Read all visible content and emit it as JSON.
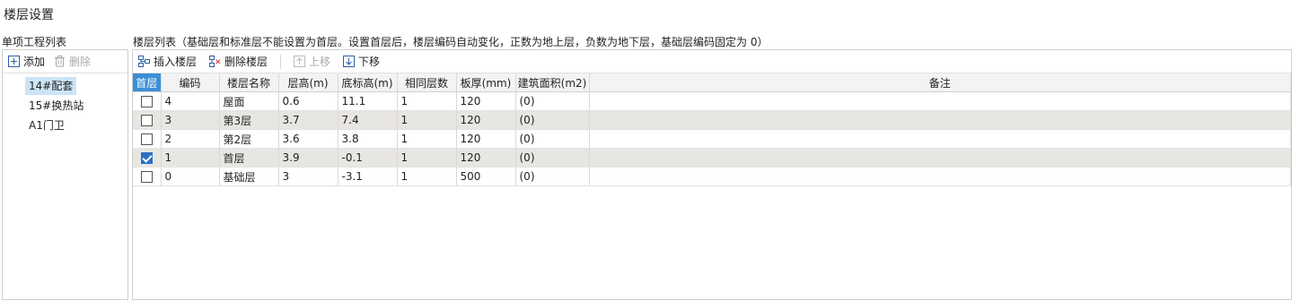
{
  "window": {
    "title": "楼层设置"
  },
  "left": {
    "label": "单项工程列表",
    "toolbar": {
      "add_label": "添加",
      "delete_label": "删除"
    },
    "items": [
      {
        "label": "14#配套",
        "selected": true
      },
      {
        "label": "15#换热站",
        "selected": false
      },
      {
        "label": "A1门卫",
        "selected": false
      }
    ]
  },
  "right": {
    "label": "楼层列表（基础层和标准层不能设置为首层。设置首层后，楼层编码自动变化，正数为地上层，负数为地下层，基础层编码固定为 0）",
    "toolbar": {
      "insert_label": "插入楼层",
      "delete_label": "删除楼层",
      "up_label": "上移",
      "down_label": "下移"
    },
    "table": {
      "headers": [
        "首层",
        "编码",
        "楼层名称",
        "层高(m)",
        "底标高(m)",
        "相同层数",
        "板厚(mm)",
        "建筑面积(m2)",
        "备注"
      ],
      "rows": [
        {
          "first": false,
          "code": "4",
          "name": "屋面",
          "height": "0.6",
          "bottom": "11.1",
          "same": "1",
          "thickness": "120",
          "area": "(0)",
          "note": ""
        },
        {
          "first": false,
          "code": "3",
          "name": "第3层",
          "height": "3.7",
          "bottom": "7.4",
          "same": "1",
          "thickness": "120",
          "area": "(0)",
          "note": ""
        },
        {
          "first": false,
          "code": "2",
          "name": "第2层",
          "height": "3.6",
          "bottom": "3.8",
          "same": "1",
          "thickness": "120",
          "area": "(0)",
          "note": ""
        },
        {
          "first": true,
          "code": "1",
          "name": "首层",
          "height": "3.9",
          "bottom": "-0.1",
          "same": "1",
          "thickness": "120",
          "area": "(0)",
          "note": ""
        },
        {
          "first": false,
          "code": "0",
          "name": "基础层",
          "height": "3",
          "bottom": "-3.1",
          "same": "1",
          "thickness": "500",
          "area": "(0)",
          "note": ""
        }
      ]
    }
  },
  "colors": {
    "accent": "#3c8fd6",
    "selection": "#cce4f7",
    "alt_row": "#e8e6e3"
  }
}
